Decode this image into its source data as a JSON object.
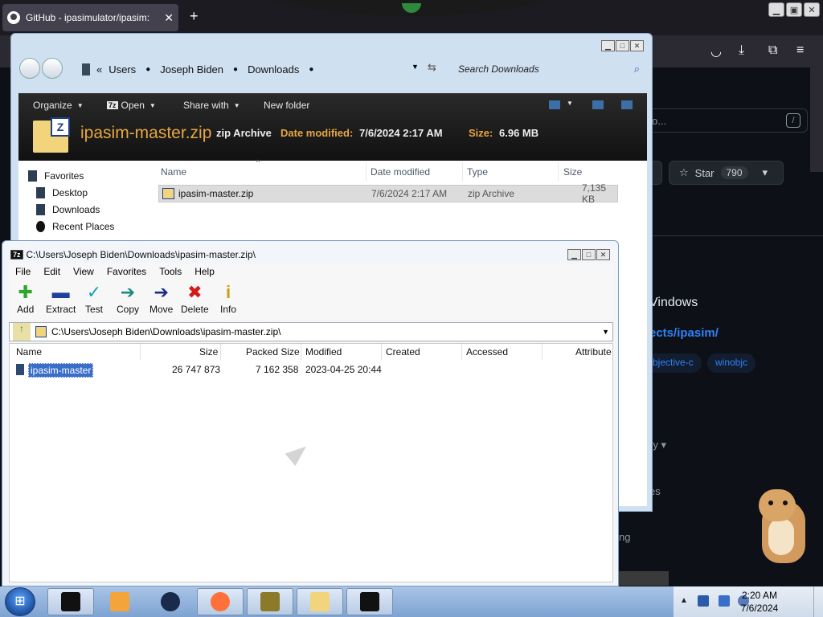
{
  "browser": {
    "tab_title": "GitHub - ipasimulator/ipasim:",
    "tab_close": "✕",
    "new_tab": "+",
    "search_text": "o...",
    "search_shortcut": "/",
    "star_label": "Star",
    "star_count": "790",
    "repo_title_fragment": "Vindows",
    "repo_link_fragment": "ects/ipasim/",
    "topics": [
      "bjective-c",
      "winobjc"
    ],
    "frag_ry": "ry ▾",
    "frag_es": "es",
    "frag_ng": "ng"
  },
  "explorer": {
    "breadcrumb": [
      "Users",
      "Joseph Biden",
      "Downloads"
    ],
    "search_placeholder": "Search Downloads",
    "commands": {
      "organize": "Organize",
      "open": "Open",
      "share_with": "Share with",
      "new_folder": "New folder"
    },
    "details": {
      "name": "ipasim-master.zip",
      "type": "zip Archive",
      "date_label": "Date modified:",
      "date_value": "7/6/2024 2:17 AM",
      "size_label": "Size:",
      "size_value": "6.96 MB"
    },
    "nav": {
      "favorites": "Favorites",
      "desktop": "Desktop",
      "downloads": "Downloads",
      "recent": "Recent Places"
    },
    "columns": {
      "name": "Name",
      "date": "Date modified",
      "type": "Type",
      "size": "Size"
    },
    "row": {
      "name": "ipasim-master.zip",
      "date": "7/6/2024 2:17 AM",
      "type": "zip Archive",
      "size": "7,135 KB"
    }
  },
  "sevenzip": {
    "title": "C:\\Users\\Joseph Biden\\Downloads\\ipasim-master.zip\\",
    "menu": [
      "File",
      "Edit",
      "View",
      "Favorites",
      "Tools",
      "Help"
    ],
    "tools": {
      "add": "Add",
      "extract": "Extract",
      "test": "Test",
      "copy": "Copy",
      "move": "Move",
      "delete": "Delete",
      "info": "Info"
    },
    "path": "C:\\Users\\Joseph Biden\\Downloads\\ipasim-master.zip\\",
    "columns": {
      "name": "Name",
      "size": "Size",
      "packed": "Packed Size",
      "modified": "Modified",
      "created": "Created",
      "accessed": "Accessed",
      "attributes": "Attribute"
    },
    "row": {
      "name": "ipasim-master",
      "size": "26 747 873",
      "packed": "7 162 358",
      "modified": "2023-04-25 20:44"
    }
  },
  "taskbar": {
    "time": "2:20 AM",
    "date": "7/6/2024",
    "tray_arrow": "▲"
  },
  "icons": {
    "sz_badge": "7z",
    "tab_glyph": "github-icon",
    "colors": {
      "details_accent": "#e8a640",
      "selection": "#3a6ec8",
      "github_link": "#2f81f7"
    }
  }
}
